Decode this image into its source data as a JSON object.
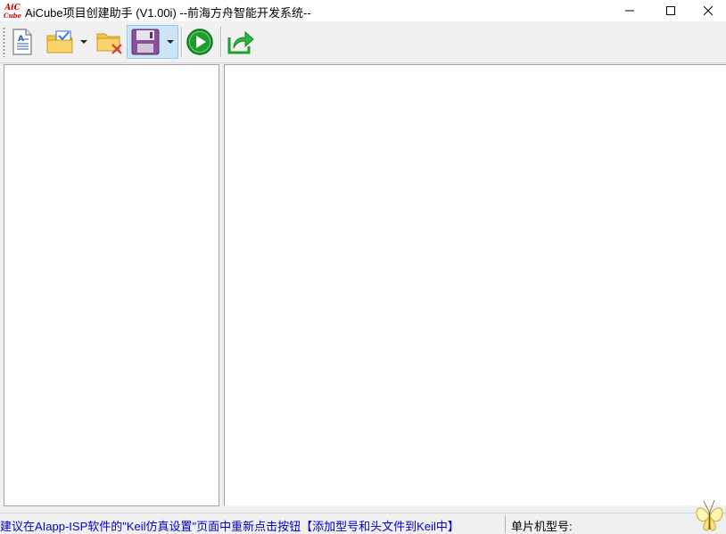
{
  "window": {
    "logo_top": "AiC",
    "logo_bottom": "Cube",
    "title": "AiCube项目创建助手 (V1.00i) --前海方舟智能开发系统--",
    "controls": [
      "minimize-icon",
      "maximize-icon",
      "close-icon"
    ]
  },
  "toolbar": {
    "buttons": [
      {
        "name": "new-project",
        "icon": "document-icon"
      },
      {
        "name": "open-project",
        "icon": "folder-check-icon",
        "has_dropdown": true
      },
      {
        "name": "close-project",
        "icon": "folder-delete-icon"
      },
      {
        "name": "save-project",
        "icon": "floppy-disk-icon",
        "has_dropdown": true,
        "pressed": true
      },
      {
        "name": "run",
        "icon": "play-icon"
      },
      {
        "name": "export",
        "icon": "share-arrow-icon"
      }
    ],
    "new_doc_letter": "A"
  },
  "statusbar": {
    "hint": "建议在AIapp-ISP软件的\"Keil仿真设置\"页面中重新点击按钮【添加型号和头文件到Keil中】",
    "mcu_label": "单片机型号:",
    "mcu_value": ""
  },
  "colors": {
    "hint_text": "#0000cc",
    "logo_red": "#cc0000",
    "folder_yellow": "#f5c542",
    "run_green": "#1e9e2e",
    "floppy_purple": "#8a4f9e"
  }
}
